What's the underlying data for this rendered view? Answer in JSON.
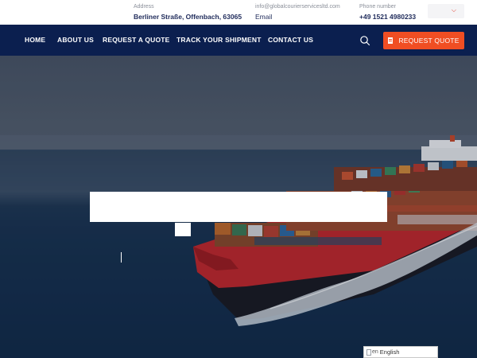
{
  "topbar": {
    "address": {
      "label": "Address",
      "value": "Berliner Straße, Offenbach, 63065"
    },
    "email": {
      "label": "info@globalcourierservicesltd.com",
      "value": "Email"
    },
    "phone": {
      "label": "Phone number",
      "value": "+49 1521 4980233"
    },
    "language_icon": "chevron-down-icon"
  },
  "nav": {
    "items": [
      {
        "label": "HOME"
      },
      {
        "label": "ABOUT US"
      },
      {
        "label": "REQUEST A QUOTE"
      },
      {
        "label": "TRACK YOUR SHIPMENT"
      },
      {
        "label": "CONTACT US"
      }
    ],
    "search_icon": "search-icon",
    "cta_label": "REQUEST QUOTE",
    "cta_icon": "document-icon"
  },
  "hero": {
    "image": "container-ship-at-sea"
  },
  "translate_widget": {
    "flag_code": "en",
    "label": "English"
  },
  "colors": {
    "nav_bg": "#0b1f4f",
    "accent": "#f04e23",
    "brand_text": "#1e2a5a"
  }
}
